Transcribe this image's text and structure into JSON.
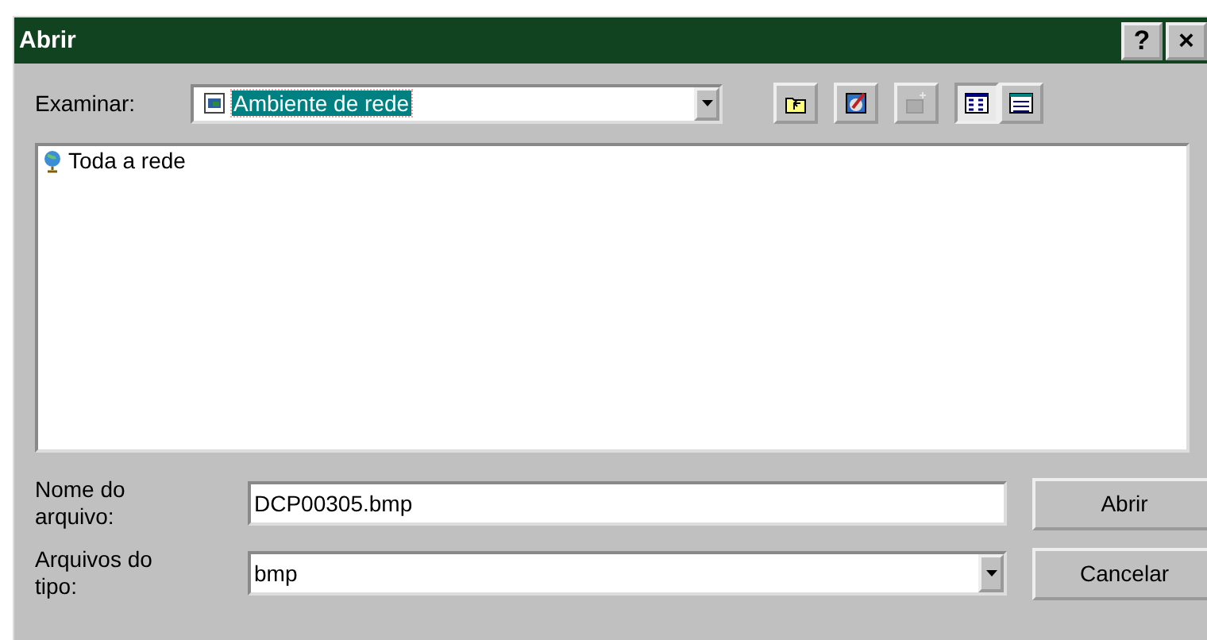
{
  "window": {
    "title": "Abrir",
    "title_buttons": [
      "?",
      "×"
    ]
  },
  "look_in": {
    "label": "Examinar:",
    "value": "Ambiente de rede"
  },
  "toolbar": [
    {
      "kind": "up",
      "disabled": false,
      "selected": false
    },
    {
      "kind": "desktop",
      "disabled": false,
      "selected": false
    },
    {
      "kind": "newfolder",
      "disabled": true,
      "selected": false
    },
    {
      "kind": "list",
      "disabled": false,
      "selected": true
    },
    {
      "kind": "details",
      "disabled": false,
      "selected": false
    }
  ],
  "files": [
    {
      "name": "Toda a rede"
    }
  ],
  "file_name": {
    "label": "Nome do arquivo:",
    "value": "DCP00305.bmp"
  },
  "file_type": {
    "label": "Arquivos do tipo:",
    "value": "bmp"
  },
  "buttons": [
    "Abrir",
    "Cancelar"
  ]
}
